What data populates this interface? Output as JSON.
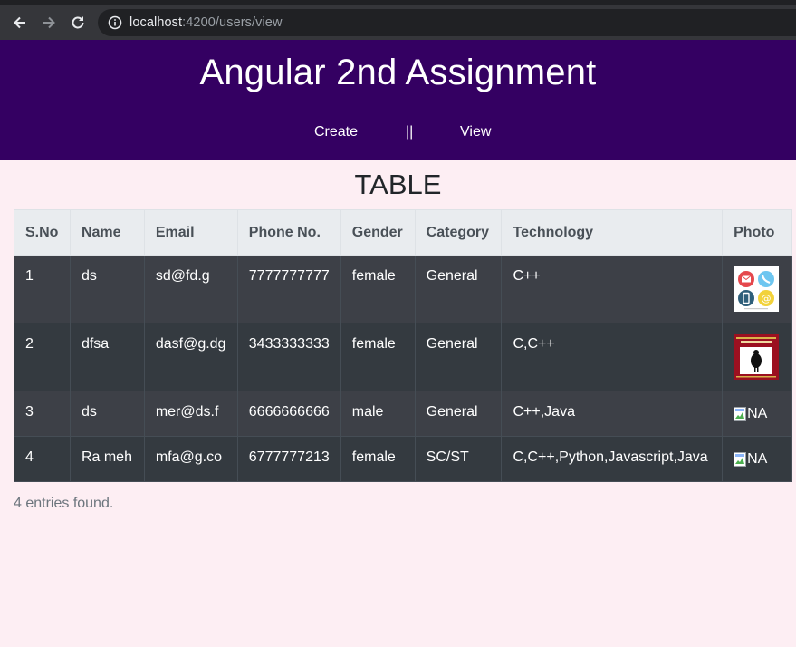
{
  "browser": {
    "url_host": "localhost",
    "url_rest": ":4200/users/view"
  },
  "header": {
    "title": "Angular 2nd Assignment",
    "nav": {
      "create": "Create",
      "separator": "||",
      "view": "View"
    }
  },
  "table": {
    "title": "TABLE",
    "columns": [
      "S.No",
      "Name",
      "Email",
      "Phone No.",
      "Gender",
      "Category",
      "Technology",
      "Photo"
    ],
    "rows": [
      {
        "sno": "1",
        "name": "ds",
        "email": "sd@fd.g",
        "phone": "7777777777",
        "gender": "female",
        "category": "General",
        "technology": "C++",
        "photo": "contact-icons-image"
      },
      {
        "sno": "2",
        "name": "dfsa",
        "email": "dasf@g.dg",
        "phone": "3433333333",
        "gender": "female",
        "category": "General",
        "technology": "C,C++",
        "photo": "book-cover-image"
      },
      {
        "sno": "3",
        "name": "ds",
        "email": "mer@ds.f",
        "phone": "6666666666",
        "gender": "male",
        "category": "General",
        "technology": "C++,Java",
        "photo_alt": "NA"
      },
      {
        "sno": "4",
        "name": "Ra meh",
        "email": "mfa@g.co",
        "phone": "6777777213",
        "gender": "female",
        "category": "SC/ST",
        "technology": "C,C++,Python,Javascript,Java",
        "photo_alt": "NA"
      }
    ],
    "footer": "4 entries found."
  }
}
